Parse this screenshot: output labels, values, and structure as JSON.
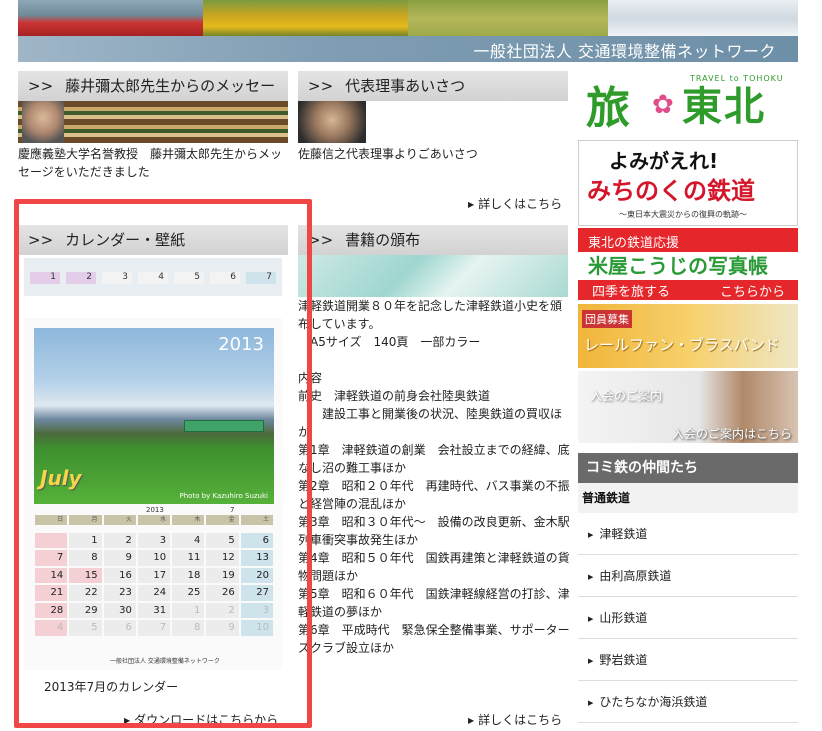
{
  "header": {
    "org_name": "一般社団法人 交通環境整備ネットワーク"
  },
  "sections": {
    "fujii": {
      "arrows": ">>",
      "title": "藤井彌太郎先生からのメッセージ",
      "text": "慶應義塾大学名誉教授　藤井彌太郎先生からメッセージをいただきました"
    },
    "greeting": {
      "arrows": ">>",
      "title": "代表理事あいさつ",
      "text": "佐藤信之代表理事よりごあいさつ",
      "more": "詳しくはこちら"
    },
    "calendar": {
      "arrows": ">>",
      "title": "カレンダー・壁紙",
      "caption": "2013年7月のカレンダー",
      "download": "ダウンロードはこちらから",
      "year": "2013",
      "month": "July",
      "credit": "Photo by Kazuhiro Suzuki",
      "footer_org": "一般社団法人 交通環境整備ネットワーク",
      "strip_days": [
        "1",
        "2",
        "3",
        "4",
        "5",
        "6",
        "7"
      ],
      "weekday_headers": [
        "日",
        "月",
        "火",
        "水",
        "木",
        "金",
        "土"
      ],
      "title_year": "2013",
      "title_month": "7",
      "weeks": [
        [
          "",
          "1",
          "2",
          "3",
          "4",
          "5",
          "6"
        ],
        [
          "7",
          "8",
          "9",
          "10",
          "11",
          "12",
          "13"
        ],
        [
          "14",
          "15",
          "16",
          "17",
          "18",
          "19",
          "20"
        ],
        [
          "21",
          "22",
          "23",
          "24",
          "25",
          "26",
          "27"
        ],
        [
          "28",
          "29",
          "30",
          "31",
          "1",
          "2",
          "3"
        ],
        [
          "4",
          "5",
          "6",
          "7",
          "8",
          "9",
          "10"
        ]
      ]
    },
    "books": {
      "arrows": ">>",
      "title": "書籍の頒布",
      "lines": [
        "津軽鉄道開業８０年を記念した津軽鉄道小史を頒布しています。",
        "　A5サイズ　140頁　一部カラー",
        "",
        "内容",
        "前史　津軽鉄道の前身会社陸奥鉄道",
        "　　建設工事と開業後の状況、陸奥鉄道の買収ほか",
        "第1章　津軽鉄道の創業　会社設立までの経緯、底なし沼の難工事ほか",
        "第2章　昭和２０年代　再建時代、バス事業の不振と経営陣の混乱ほか",
        "第3章　昭和３０年代〜　設備の改良更新、金木駅列車衝突事故発生ほか",
        "第4章　昭和５０年代　国鉄再建策と津軽鉄道の貨物問題ほか",
        "第5章　昭和６０年代　国鉄津軽線経営の打診、津軽鉄道の夢ほか",
        "第6章　平成時代　緊急保全整備事業、サポーターズクラブ設立ほか"
      ],
      "more": "詳しくはこちら"
    }
  },
  "sidebar": {
    "tabi": {
      "sub": "TRAVEL to TOHOKU",
      "left": "旅",
      "flower": "✿",
      "right": "東北"
    },
    "michinoku": {
      "line1": "よみがえれ!",
      "line2": "みちのくの鉄道",
      "line3": "〜東日本大震災からの復興の軌跡〜"
    },
    "yoneya": {
      "line1": "東北の鉄道応援",
      "line2": "米屋こうじの写真帳",
      "line3": "四季を旅する",
      "line4": "こちらから"
    },
    "brass": {
      "badge": "団員募集",
      "title": "レールファン・ブラスバンド"
    },
    "join": {
      "title": "入会のご案内",
      "link": "入会のご案内はこちら"
    },
    "komitetsu": {
      "title": "コミ鉄の仲間たち",
      "category": "普通鉄道",
      "items": [
        "津軽鉄道",
        "由利高原鉄道",
        "山形鉄道",
        "野岩鉄道",
        "ひたちなか海浜鉄道"
      ]
    }
  },
  "colors": {
    "highlight": "#f04646",
    "accent_green": "#2f9b2b",
    "accent_red": "#e5262a"
  }
}
